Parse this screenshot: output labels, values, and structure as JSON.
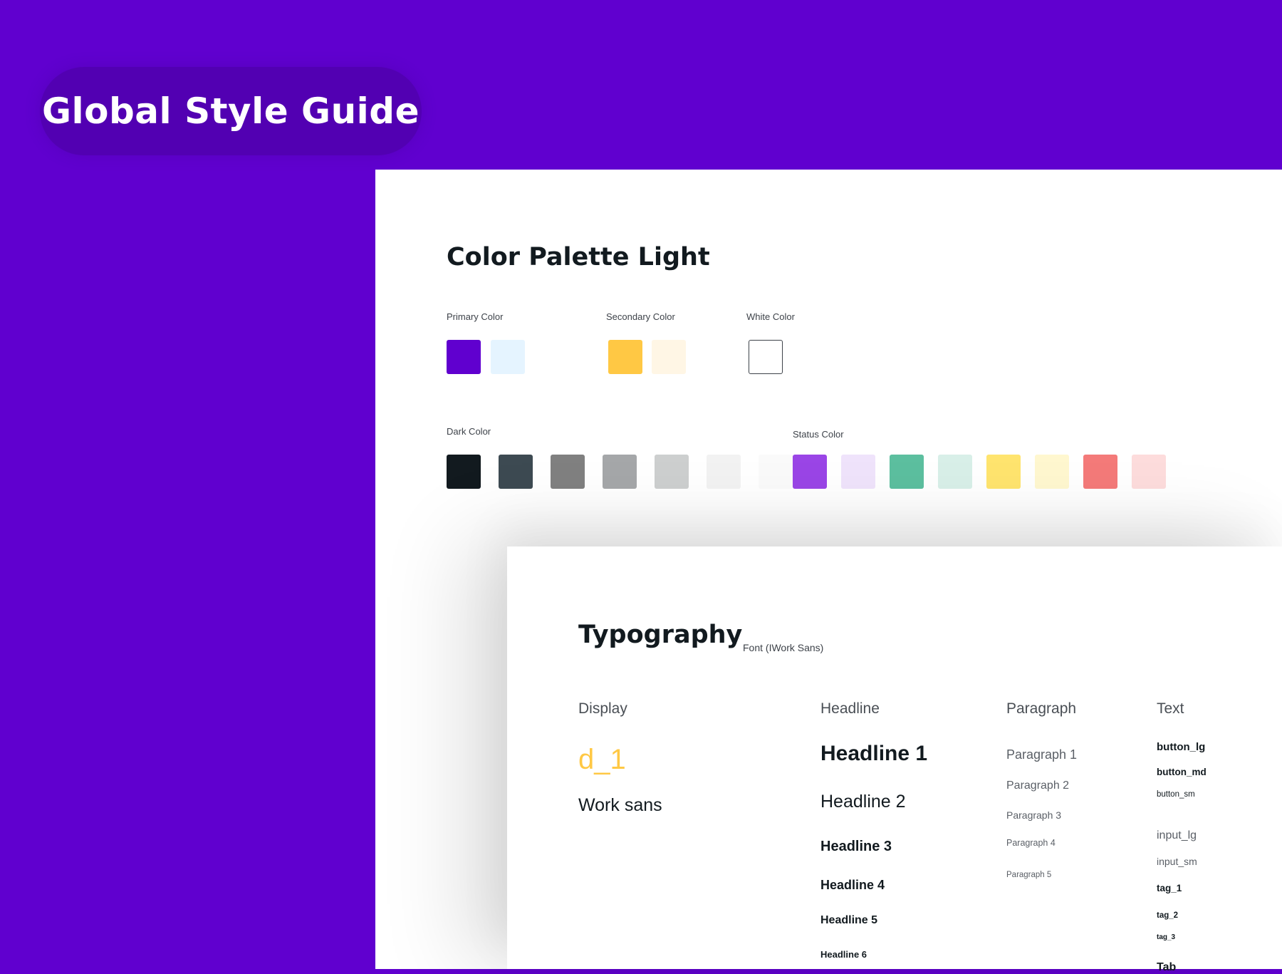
{
  "hero": {
    "title": "Global Style Guide"
  },
  "palette": {
    "title": "Color Palette Light",
    "primary": {
      "label": "Primary Color",
      "swatches": [
        "#6000cf",
        "#e5f4ff"
      ]
    },
    "secondary": {
      "label": "Secondary Color",
      "swatches": [
        "#ffc844",
        "#fff6e5"
      ]
    },
    "white": {
      "label": "White Color",
      "swatches": [
        "#ffffff"
      ]
    },
    "dark": {
      "label": "Dark Color",
      "swatches": [
        "#121a1f",
        "#3d4a52",
        "#808080",
        "#a5a7a9",
        "#cdcfcf",
        "#f2f2f2",
        "#fafafa"
      ]
    },
    "status": {
      "label": "Status Color",
      "swatches": [
        "#9a45e6",
        "#efe3fb",
        "#5cbf9f",
        "#d8efe8",
        "#ffe46e",
        "#fff7cf",
        "#f47a79",
        "#fddcdc"
      ]
    }
  },
  "typography": {
    "title": "Typography",
    "font_note": "Font (IWork Sans)",
    "display": {
      "heading": "Display",
      "d1": "d_1",
      "sample": "Work sans"
    },
    "headline": {
      "heading": "Headline",
      "items": [
        "Headline 1",
        "Headline 2",
        "Headline 3",
        "Headline 4",
        "Headline 5",
        "Headline 6"
      ]
    },
    "paragraph": {
      "heading": "Paragraph",
      "items": [
        "Paragraph 1",
        "Paragraph 2",
        "Paragraph 3",
        "Paragraph 4",
        "Paragraph 5"
      ]
    },
    "text": {
      "heading": "Text",
      "items": [
        "button_lg",
        "button_md",
        "button_sm",
        "input_lg",
        "input_sm",
        "tag_1",
        "tag_2",
        "tag_3",
        "Tab"
      ]
    }
  },
  "colors": {
    "accent": "#6000cf",
    "display_yellow": "#ffc844",
    "ink": "#121a1f"
  }
}
